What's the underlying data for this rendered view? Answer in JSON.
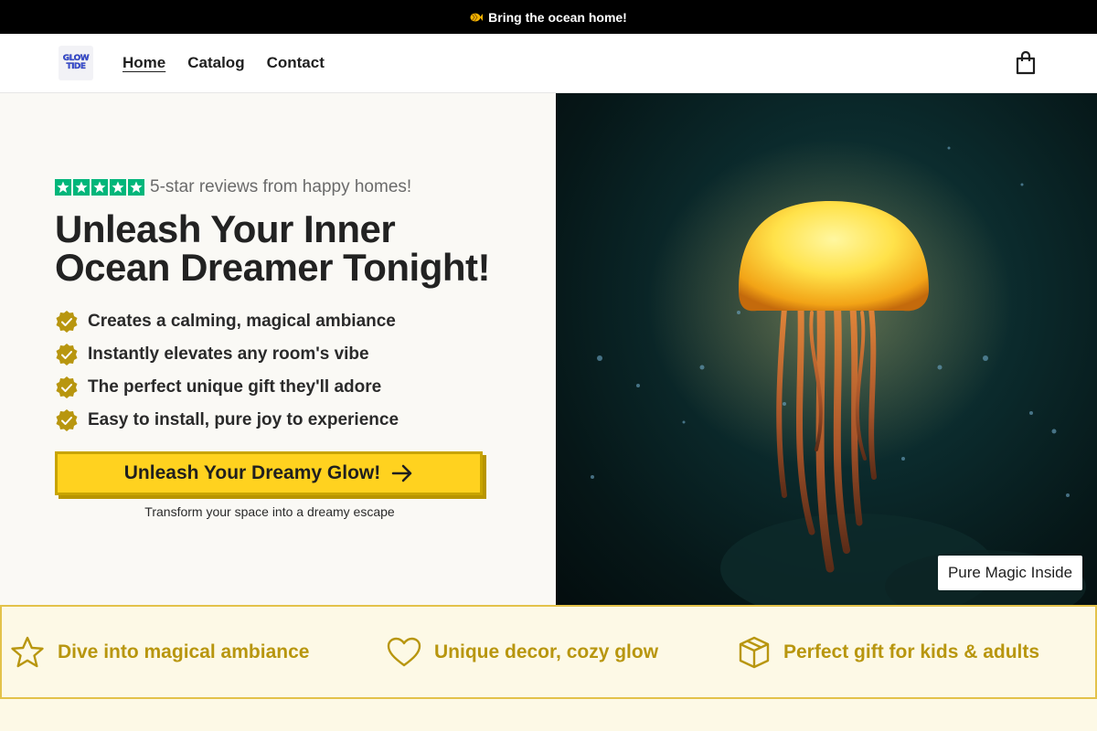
{
  "announcement": {
    "text": "Bring the ocean home!",
    "icon": "fish-icon"
  },
  "header": {
    "logo_lines": [
      "GLOW",
      "TIDE"
    ],
    "nav": [
      {
        "label": "Home",
        "active": true
      },
      {
        "label": "Catalog",
        "active": false
      },
      {
        "label": "Contact",
        "active": false
      }
    ],
    "cart_icon": "shopping-bag-icon"
  },
  "hero": {
    "rating_stars": 5,
    "reviews_text": "5-star reviews from happy homes!",
    "headline_line1": "Unleash Your Inner",
    "headline_line2": "Ocean Dreamer Tonight!",
    "benefits": [
      "Creates a calming, magical ambiance",
      "Instantly elevates any room's vibe",
      "The perfect unique gift they'll adore",
      "Easy to install, pure joy to experience"
    ],
    "cta_label": "Unleash Your Dreamy Glow!",
    "cta_subtext": "Transform your space into a dreamy escape",
    "image_badge": "Pure Magic Inside"
  },
  "features": [
    {
      "icon": "star-outline-icon",
      "text": "Dive into magical ambiance"
    },
    {
      "icon": "heart-outline-icon",
      "text": "Unique decor, cozy glow"
    },
    {
      "icon": "box-icon",
      "text": "Perfect gift for kids & adults"
    }
  ],
  "colors": {
    "accent_yellow": "#ffd21f",
    "feature_gold": "#b8960f",
    "check_gold": "#b8960f",
    "trustpilot_green": "#00b67a"
  }
}
